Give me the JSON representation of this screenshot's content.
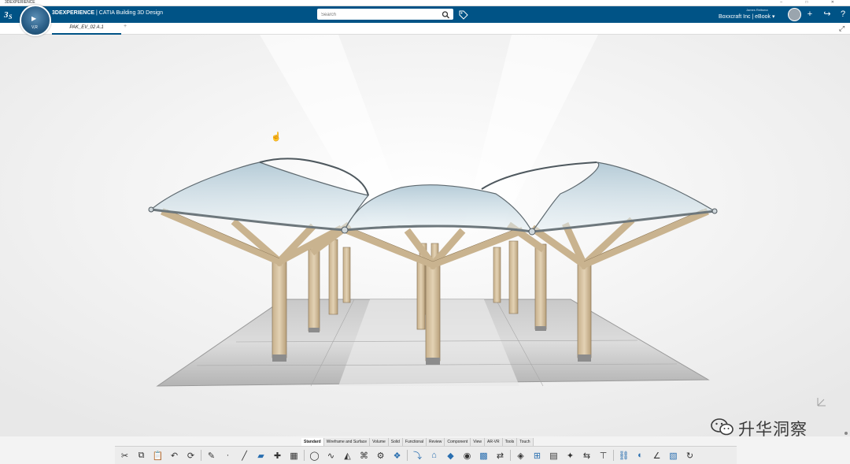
{
  "window": {
    "title": "3DEXPERIENCE",
    "controls": "–  □  ✕"
  },
  "header": {
    "brand_bold": "3DEXPERIENCE",
    "brand_rest": " | CATIA Building 3D Design",
    "search_placeholder": "Search",
    "user_name": "James Reitsma",
    "company": "Boxxcraft Inc | eBook ▾",
    "compass_label": "V,R"
  },
  "tabs": [
    {
      "label": "PAK_EV_02 A.1"
    }
  ],
  "action_bar": {
    "tabs": [
      "Standard",
      "Wireframe and Surface",
      "Volume",
      "Solid",
      "Functional",
      "Review",
      "Component",
      "View",
      "AR-VR",
      "Tools",
      "Touch"
    ],
    "active": "Standard"
  },
  "toolbar": {
    "tools": [
      {
        "icon": "cut-icon",
        "glyph": "✂"
      },
      {
        "icon": "copy-icon",
        "glyph": "⧉"
      },
      {
        "icon": "paste-icon",
        "glyph": "📋"
      },
      {
        "icon": "undo-icon",
        "glyph": "↶"
      },
      {
        "icon": "update-icon",
        "glyph": "⟳"
      },
      {
        "icon": "sketch-icon",
        "glyph": "✎"
      },
      {
        "icon": "point-icon",
        "glyph": "·"
      },
      {
        "icon": "line-icon",
        "glyph": "╱"
      },
      {
        "icon": "plane-icon",
        "glyph": "▰"
      },
      {
        "icon": "axis-system-icon",
        "glyph": "✚"
      },
      {
        "icon": "grid-icon",
        "glyph": "▦"
      },
      {
        "icon": "circle-icon",
        "glyph": "◯"
      },
      {
        "icon": "spline-icon",
        "glyph": "∿"
      },
      {
        "icon": "ramp-icon",
        "glyph": "◭"
      },
      {
        "icon": "beam-icon",
        "glyph": "⌘"
      },
      {
        "icon": "pattern-icon",
        "glyph": "⚙"
      },
      {
        "icon": "sweep-icon",
        "glyph": "❖"
      },
      {
        "icon": "pipe-icon",
        "glyph": "⤵"
      },
      {
        "icon": "house-icon",
        "glyph": "⌂"
      },
      {
        "icon": "fill-icon",
        "glyph": "◆"
      },
      {
        "icon": "view-icon",
        "glyph": "◉"
      },
      {
        "icon": "array-icon",
        "glyph": "▩"
      },
      {
        "icon": "transform-icon",
        "glyph": "⇄"
      },
      {
        "icon": "split-icon",
        "glyph": "◈"
      },
      {
        "icon": "measure-icon",
        "glyph": "⊞"
      },
      {
        "icon": "table-icon",
        "glyph": "▤"
      },
      {
        "icon": "wand-icon",
        "glyph": "✦"
      },
      {
        "icon": "swap-icon",
        "glyph": "⇆"
      },
      {
        "icon": "dimension-icon",
        "glyph": "⊤"
      },
      {
        "icon": "link-icon",
        "glyph": "⛓"
      },
      {
        "icon": "render-icon",
        "glyph": "◐"
      },
      {
        "icon": "analysis-icon",
        "glyph": "∠"
      },
      {
        "icon": "texture-icon",
        "glyph": "▧"
      },
      {
        "icon": "more-icon",
        "glyph": "↻"
      }
    ]
  },
  "watermark": {
    "text": "升华洞察"
  },
  "colors": {
    "header": "#005386",
    "viewport": "#f3f3f3",
    "toolbar": "#ececec",
    "wood": "#d8c3a2",
    "glass": "#bcd4df"
  }
}
